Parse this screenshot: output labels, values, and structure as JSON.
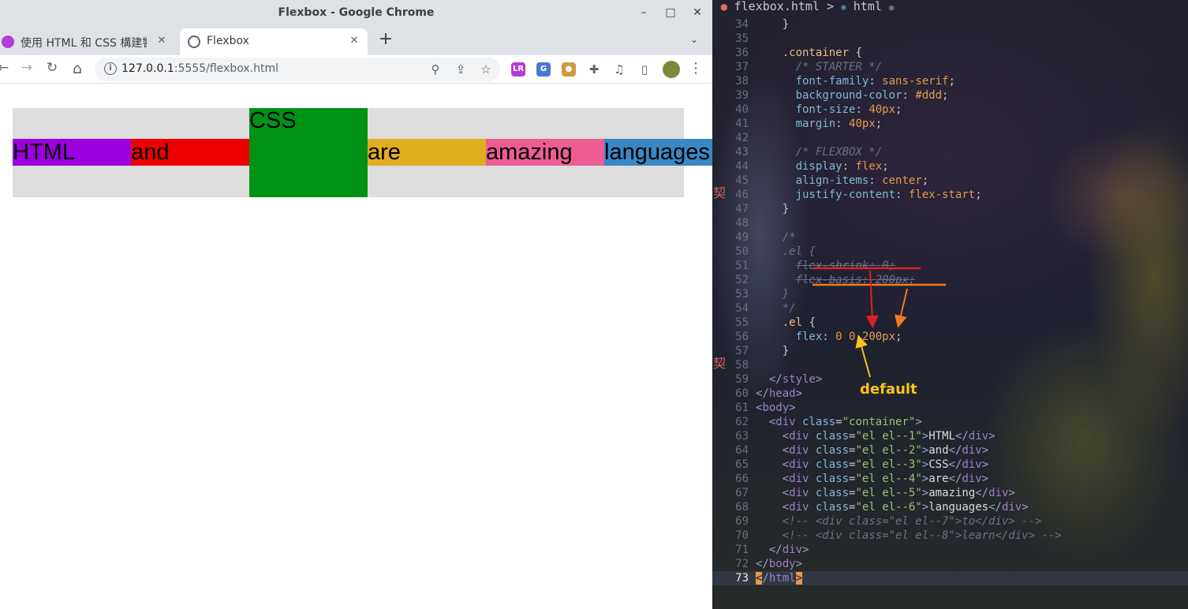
{
  "window": {
    "title": "Flexbox - Google Chrome",
    "minimize": "–",
    "maximize": "□",
    "close": "✕"
  },
  "tabs": [
    {
      "label": "使用 HTML 和 CSS 構建響應",
      "close": "✕"
    },
    {
      "label": "Flexbox",
      "close": "✕"
    }
  ],
  "tabstrip": {
    "new_tab": "+",
    "tab_search": "⌄"
  },
  "toolbar": {
    "back": "←",
    "forward": "→",
    "reload": "↻",
    "home": "⌂",
    "url_host": "127.0.0.1",
    "url_rest": ":5555/flexbox.html",
    "site_info": "i",
    "zoom": "⚲",
    "share": "⇪",
    "bookmark": "☆",
    "menu": "⋮",
    "extensions": [
      {
        "name": "lr-extension-icon",
        "label": "LR",
        "color": "#b43bd6"
      },
      {
        "name": "translate-extension-icon",
        "label": "G",
        "color": "#4a78d0"
      },
      {
        "name": "cookie-extension-icon",
        "label": "●",
        "color": "#d09a40"
      },
      {
        "name": "puzzle-extensions-icon",
        "label": "✚",
        "color": "#5f6368"
      },
      {
        "name": "media-controls-icon",
        "label": "♫",
        "color": "#5f6368"
      },
      {
        "name": "side-panel-icon",
        "label": "▯",
        "color": "#5f6368"
      },
      {
        "name": "profile-avatar",
        "label": "",
        "color": "#7a8a3a"
      }
    ]
  },
  "page": {
    "items": [
      {
        "text": "HTML",
        "color": "#9b00e0"
      },
      {
        "text": "and",
        "color": "#ee0000"
      },
      {
        "text": "CSS",
        "color": "#009214"
      },
      {
        "text": "are",
        "color": "#e0ad1f"
      },
      {
        "text": "amazing",
        "color": "#ec5d94"
      },
      {
        "text": "languages",
        "color": "#3a87c4"
      }
    ]
  },
  "editor": {
    "breadcrumb_file": "flexbox.html",
    "breadcrumb_sep": ">",
    "breadcrumb_node": "html",
    "gutter_glyph": "契",
    "annotation": "default",
    "lines": [
      {
        "n": "",
        "html": ""
      },
      {
        "n": "34",
        "html": "    <span class='t-punc'>}</span>"
      },
      {
        "n": "35",
        "html": ""
      },
      {
        "n": "36",
        "html": "    <span class='t-sel'>.container</span> <span class='t-punc'>{</span>"
      },
      {
        "n": "37",
        "html": "      <span class='t-com'>/* STARTER */</span>"
      },
      {
        "n": "38",
        "html": "      <span class='t-prop'>font-family</span><span class='t-punc'>:</span> <span class='t-val'>sans-serif</span><span class='t-punc'>;</span>"
      },
      {
        "n": "39",
        "html": "      <span class='t-prop'>background-color</span><span class='t-punc'>:</span> <span class='t-val'>#ddd</span><span class='t-punc'>;</span>"
      },
      {
        "n": "40",
        "html": "      <span class='t-prop'>font-size</span><span class='t-punc'>:</span> <span class='t-val'>40px</span><span class='t-punc'>;</span>"
      },
      {
        "n": "41",
        "html": "      <span class='t-prop'>margin</span><span class='t-punc'>:</span> <span class='t-val'>40px</span><span class='t-punc'>;</span>"
      },
      {
        "n": "42",
        "html": ""
      },
      {
        "n": "43",
        "html": "      <span class='t-com'>/* FLEXBOX */</span>"
      },
      {
        "n": "44",
        "html": "      <span class='t-prop'>display</span><span class='t-punc'>:</span> <span class='t-val'>flex</span><span class='t-punc'>;</span>"
      },
      {
        "n": "45",
        "html": "      <span class='t-prop'>align-items</span><span class='t-punc'>:</span> <span class='t-val'>center</span><span class='t-punc'>;</span>"
      },
      {
        "n": "46",
        "html": "      <span class='t-prop'>justify-content</span><span class='t-punc'>:</span> <span class='t-val'>flex-start</span><span class='t-punc'>;</span>"
      },
      {
        "n": "47",
        "html": "    <span class='t-punc'>}</span>"
      },
      {
        "n": "48",
        "html": ""
      },
      {
        "n": "49",
        "html": "    <span class='t-com'>/*</span>"
      },
      {
        "n": "50",
        "html": "    <span class='t-com'>.el {</span>"
      },
      {
        "n": "51",
        "html": "      <span class='t-com t-strike'>flex-shrink: 0;</span>"
      },
      {
        "n": "52",
        "html": "      <span class='t-com t-strike'>flex-basis: 200px;</span>"
      },
      {
        "n": "53",
        "html": "    <span class='t-com'>}</span>"
      },
      {
        "n": "54",
        "html": "    <span class='t-com'>*/</span>"
      },
      {
        "n": "55",
        "html": "    <span class='t-sel'>.el</span> <span class='t-punc'>{</span>"
      },
      {
        "n": "56",
        "html": "      <span class='t-prop'>flex</span><span class='t-punc'>:</span> <span class='t-val'>0 0 200px</span><span class='t-punc'>;</span>"
      },
      {
        "n": "57",
        "html": "    <span class='t-punc'>}</span>"
      },
      {
        "n": "58",
        "html": ""
      },
      {
        "n": "59",
        "html": "  <span class='t-tag'>&lt;/</span><span class='t-tagn'>style</span><span class='t-tag'>&gt;</span>"
      },
      {
        "n": "60",
        "html": "<span class='t-tag'>&lt;/</span><span class='t-tagn'>head</span><span class='t-tag'>&gt;</span>"
      },
      {
        "n": "61",
        "html": "<span class='t-tag'>&lt;</span><span class='t-tagn'>body</span><span class='t-tag'>&gt;</span>"
      },
      {
        "n": "62",
        "html": "  <span class='t-tag'>&lt;</span><span class='t-tagn'>div</span> <span class='t-attr'>class</span><span class='t-punc'>=</span><span class='t-str'>\"container\"</span><span class='t-tag'>&gt;</span>"
      },
      {
        "n": "63",
        "html": "    <span class='t-tag'>&lt;</span><span class='t-tagn'>div</span> <span class='t-attr'>class</span><span class='t-punc'>=</span><span class='t-str'>\"el el--1\"</span><span class='t-tag'>&gt;</span><span class='t-text'>HTML</span><span class='t-tag'>&lt;/</span><span class='t-tagn'>div</span><span class='t-tag'>&gt;</span>"
      },
      {
        "n": "64",
        "html": "    <span class='t-tag'>&lt;</span><span class='t-tagn'>div</span> <span class='t-attr'>class</span><span class='t-punc'>=</span><span class='t-str'>\"el el--2\"</span><span class='t-tag'>&gt;</span><span class='t-text'>and</span><span class='t-tag'>&lt;/</span><span class='t-tagn'>div</span><span class='t-tag'>&gt;</span>"
      },
      {
        "n": "65",
        "html": "    <span class='t-tag'>&lt;</span><span class='t-tagn'>div</span> <span class='t-attr'>class</span><span class='t-punc'>=</span><span class='t-str'>\"el el--3\"</span><span class='t-tag'>&gt;</span><span class='t-text'>CSS</span><span class='t-tag'>&lt;/</span><span class='t-tagn'>div</span><span class='t-tag'>&gt;</span>"
      },
      {
        "n": "66",
        "html": "    <span class='t-tag'>&lt;</span><span class='t-tagn'>div</span> <span class='t-attr'>class</span><span class='t-punc'>=</span><span class='t-str'>\"el el--4\"</span><span class='t-tag'>&gt;</span><span class='t-text'>are</span><span class='t-tag'>&lt;/</span><span class='t-tagn'>div</span><span class='t-tag'>&gt;</span>"
      },
      {
        "n": "67",
        "html": "    <span class='t-tag'>&lt;</span><span class='t-tagn'>div</span> <span class='t-attr'>class</span><span class='t-punc'>=</span><span class='t-str'>\"el el--5\"</span><span class='t-tag'>&gt;</span><span class='t-text'>amazing</span><span class='t-tag'>&lt;/</span><span class='t-tagn'>div</span><span class='t-tag'>&gt;</span>"
      },
      {
        "n": "68",
        "html": "    <span class='t-tag'>&lt;</span><span class='t-tagn'>div</span> <span class='t-attr'>class</span><span class='t-punc'>=</span><span class='t-str'>\"el el--6\"</span><span class='t-tag'>&gt;</span><span class='t-text'>languages</span><span class='t-tag'>&lt;/</span><span class='t-tagn'>div</span><span class='t-tag'>&gt;</span>"
      },
      {
        "n": "69",
        "html": "    <span class='t-com'>&lt;!-- &lt;div class=\"el el--7\"&gt;to&lt;/div&gt; --&gt;</span>"
      },
      {
        "n": "70",
        "html": "    <span class='t-com'>&lt;!-- &lt;div class=\"el el--8\"&gt;learn&lt;/div&gt; --&gt;</span>"
      },
      {
        "n": "71",
        "html": "  <span class='t-tag'>&lt;/</span><span class='t-tagn'>div</span><span class='t-tag'>&gt;</span>"
      },
      {
        "n": "72",
        "html": "<span class='t-tag'>&lt;/</span><span class='t-tagn'>body</span><span class='t-tag'>&gt;</span>"
      },
      {
        "n": "73",
        "html": "<span class='cursor-block'>&lt;</span><span class='t-tag'>/</span><span class='t-tagn'>html</span><span class='cursor-block'>&gt;</span>",
        "current": true
      }
    ]
  }
}
